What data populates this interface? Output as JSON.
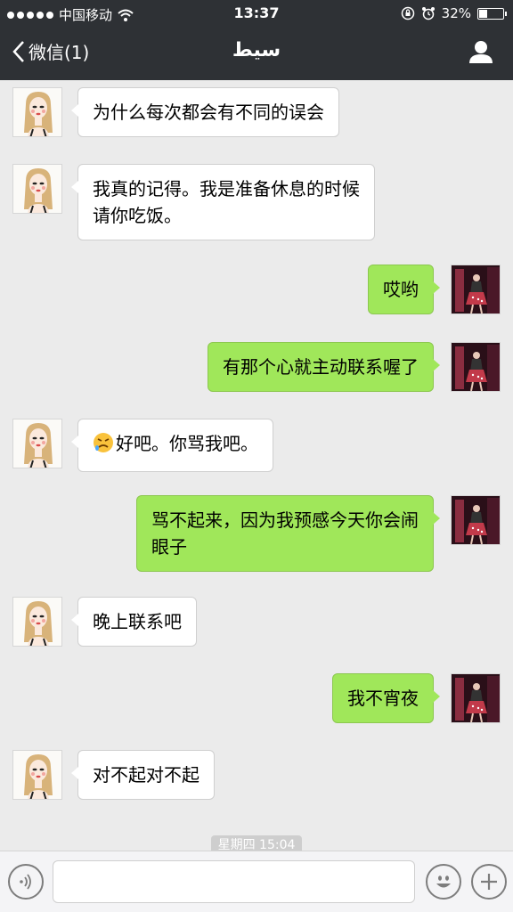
{
  "status_bar": {
    "carrier": "中国移动",
    "time": "13:37",
    "battery": "32%",
    "battery_level": 0.32
  },
  "nav": {
    "back_label": "微信(1)",
    "title": "سيط"
  },
  "messages": [
    {
      "from": "them",
      "text": "为什么每次都会有不同的误会"
    },
    {
      "from": "them",
      "lines": [
        "我真的记得。我是准备休息的时候",
        "请你吃饭。"
      ]
    },
    {
      "from": "me",
      "text": "哎哟"
    },
    {
      "from": "me",
      "text": "有那个心就主动联系喔了"
    },
    {
      "from": "them",
      "emoji": "angry-face-icon",
      "text": "好吧。你骂我吧。"
    },
    {
      "from": "me",
      "lines": [
        "骂不起来，因为我预感今天你会闹",
        "眼子"
      ]
    },
    {
      "from": "them",
      "text": "晚上联系吧"
    },
    {
      "from": "me",
      "text": "我不宵夜"
    },
    {
      "from": "them",
      "text": "对不起对不起"
    }
  ],
  "timestamp": "星期四 15:04",
  "input": {
    "value": "",
    "placeholder": ""
  },
  "colors": {
    "header": "#2e3135",
    "my_bubble": "#a0e75a",
    "their_bubble": "#ffffff",
    "background": "#ebebeb"
  }
}
